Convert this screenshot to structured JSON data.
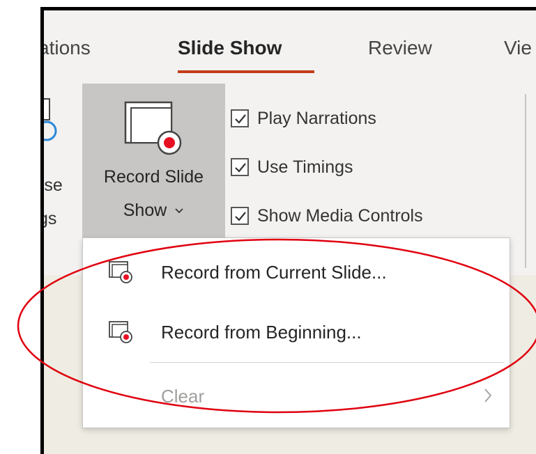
{
  "tabs": {
    "items": [
      "ations",
      "Slide Show",
      "Review",
      "Vie"
    ],
    "active": "Slide Show"
  },
  "ribbon": {
    "left_partial": {
      "line1": "rse",
      "line2": "gs"
    },
    "record_button": {
      "line1": "Record Slide",
      "line2": "Show",
      "dropdown_icon": "chevron-down-icon"
    },
    "checkboxes": [
      {
        "label": "Play Narrations",
        "checked": true
      },
      {
        "label": "Use Timings",
        "checked": true
      },
      {
        "label": "Show Media Controls",
        "checked": true
      }
    ]
  },
  "menu": {
    "items": [
      {
        "label": "Record from Current Slide...",
        "icon": "record-slide-icon",
        "enabled": true
      },
      {
        "label": "Record from Beginning...",
        "icon": "record-slide-icon",
        "enabled": true
      },
      {
        "label": "Clear",
        "enabled": false,
        "has_submenu": true
      }
    ]
  },
  "colors": {
    "accent": "#c43e1c",
    "record_dot": "#e81123",
    "annotation": "#e0000f"
  }
}
